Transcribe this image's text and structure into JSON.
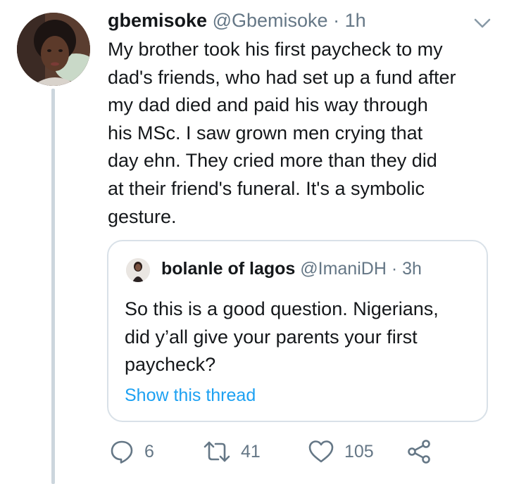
{
  "tweet": {
    "author_name": "gbemisoke",
    "author_handle": "@Gbemisoke",
    "separator": "·",
    "time": "1h",
    "text": "My brother took his first paycheck to my\ndad's friends, who had set up a fund after\nmy dad died and paid his way through\nhis MSc. I saw grown men crying that\nday ehn. They cried more than they did\nat their friend's funeral. It's a symbolic\ngesture."
  },
  "quoted_tweet": {
    "author_name": "bolanle of lagos",
    "author_handle": "@ImaniDH",
    "separator": "·",
    "time": "3h",
    "text": "So this is a good question. Nigerians,\ndid y’all give your parents your first\npaycheck?",
    "link_label": "Show this thread"
  },
  "actions": {
    "reply_count": "6",
    "retweet_count": "41",
    "like_count": "105"
  },
  "icons": {
    "menu": "chevron-down-icon",
    "reply": "reply-icon",
    "retweet": "retweet-icon",
    "like": "heart-icon",
    "share": "share-icon"
  },
  "colors": {
    "text": "#14171a",
    "secondary": "#657786",
    "link": "#1da1f2",
    "thread_line": "#ccd6dd",
    "border": "#d9e1e8"
  }
}
